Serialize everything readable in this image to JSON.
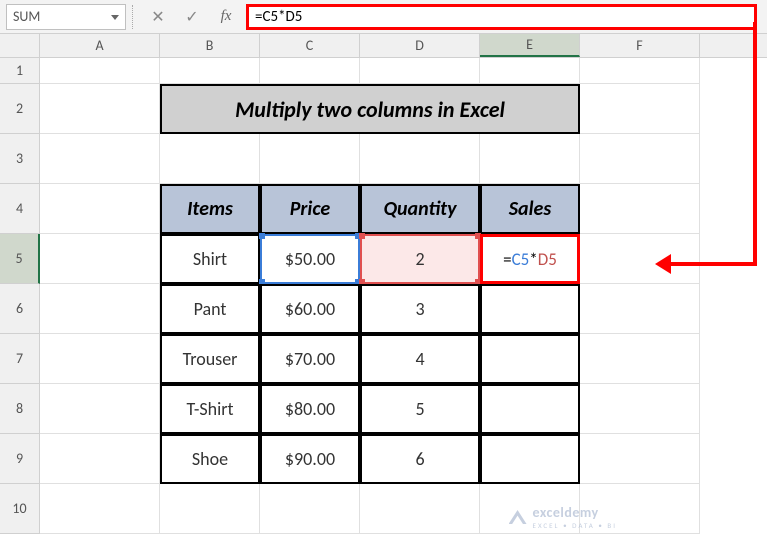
{
  "nameBox": "SUM",
  "formulaBar": "=C5*D5",
  "columns": [
    "A",
    "B",
    "C",
    "D",
    "E",
    "F"
  ],
  "rows": [
    "1",
    "2",
    "3",
    "4",
    "5",
    "6",
    "7",
    "8",
    "9",
    "10"
  ],
  "activeRow": "5",
  "activeCol": "E",
  "title": "Multiply two columns in Excel",
  "headers": {
    "items": "Items",
    "price": "Price",
    "quantity": "Quantity",
    "sales": "Sales"
  },
  "data": [
    {
      "item": "Shirt",
      "price": "$50.00",
      "quantity": "2",
      "sales_formula": {
        "eq": "=",
        "ref1": "C5",
        "op": "*",
        "ref2": "D5"
      }
    },
    {
      "item": "Pant",
      "price": "$60.00",
      "quantity": "3",
      "sales": ""
    },
    {
      "item": "Trouser",
      "price": "$70.00",
      "quantity": "4",
      "sales": ""
    },
    {
      "item": "T-Shirt",
      "price": "$80.00",
      "quantity": "5",
      "sales": ""
    },
    {
      "item": "Shoe",
      "price": "$90.00",
      "quantity": "6",
      "sales": ""
    }
  ],
  "watermark": {
    "brand": "exceldemy",
    "tagline": "EXCEL • DATA • BI"
  }
}
